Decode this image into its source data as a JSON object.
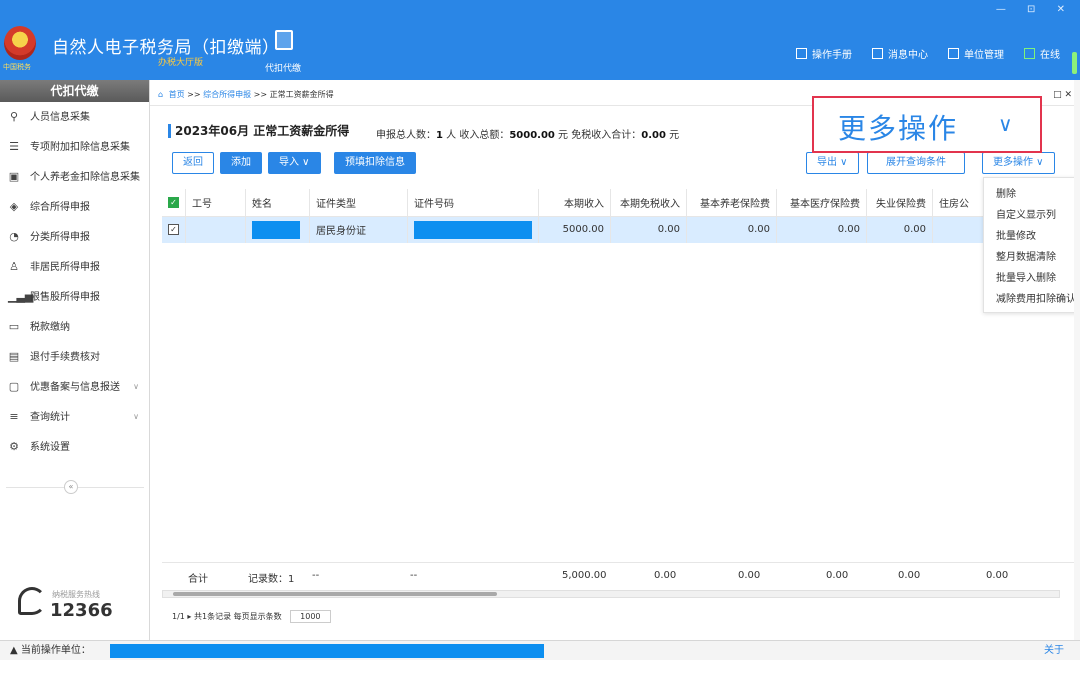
{
  "app": {
    "title": "自然人电子税务局（扣缴端）",
    "subtitle": "办税大厅版",
    "logo_text": "中国税务",
    "nav_label": "代扣代缴",
    "window_controls": "—  ⊡  ✕"
  },
  "top_actions": [
    {
      "label": "操作手册",
      "icon": "manual-icon"
    },
    {
      "label": "消息中心",
      "icon": "mail-icon"
    },
    {
      "label": "单位管理",
      "icon": "building-icon"
    },
    {
      "label": "在线",
      "icon": "online-icon"
    }
  ],
  "sidebar": {
    "header": "代扣代缴",
    "items": [
      {
        "label": "人员信息采集",
        "icon": "person-icon"
      },
      {
        "label": "专项附加扣除信息采集",
        "icon": "list-icon"
      },
      {
        "label": "个人养老金扣除信息采集",
        "icon": "pension-icon"
      },
      {
        "label": "综合所得申报",
        "icon": "layers-icon"
      },
      {
        "label": "分类所得申报",
        "icon": "pie-icon"
      },
      {
        "label": "非居民所得申报",
        "icon": "user-outline-icon"
      },
      {
        "label": "限售股所得申报",
        "icon": "bar-icon"
      },
      {
        "label": "税款缴纳",
        "icon": "wallet-icon"
      },
      {
        "label": "退付手续费核对",
        "icon": "doc-icon"
      },
      {
        "label": "优惠备案与信息报送",
        "icon": "folder-icon",
        "expandable": true
      },
      {
        "label": "查询统计",
        "icon": "search-list-icon",
        "expandable": true
      },
      {
        "label": "系统设置",
        "icon": "gear-icon"
      }
    ],
    "collapse": "«",
    "hotline_label": "纳税服务热线",
    "hotline_number": "12366"
  },
  "breadcrumb": {
    "home": "首页",
    "sep": ">>",
    "level1": "综合所得申报",
    "current": "正常工资薪金所得",
    "close": "□ ✕"
  },
  "page": {
    "title": "2023年06月 正常工资薪金所得",
    "stats_prefix": "申报总人数：",
    "stats_count": "1",
    "stats_count_unit": " 人   收入总额：",
    "stats_income": "5000.00",
    "stats_income_unit": " 元   免税收入合计：",
    "stats_exempt": "0.00",
    "stats_exempt_unit": " 元"
  },
  "toolbar": {
    "back": "返回",
    "add": "添加",
    "import": "导入 ∨",
    "prefill": "预填扣除信息",
    "export": "导出 ∨",
    "expand_query": "展开查询条件",
    "more": "更多操作 ∨"
  },
  "table": {
    "columns": [
      "工号",
      "姓名",
      "证件类型",
      "证件号码",
      "本期收入",
      "本期免税收入",
      "基本养老保险费",
      "基本医疗保险费",
      "失业保险费",
      "住房公"
    ],
    "rows": [
      {
        "id": "",
        "name": "",
        "id_type": "居民身份证",
        "id_number": "",
        "income": "5000.00",
        "exempt": "0.00",
        "pension": "0.00",
        "medical": "0.00",
        "unemployment": "0.00",
        "housing": ""
      }
    ]
  },
  "footer": {
    "total_label": "合计",
    "records": "记录数：1",
    "dash1": "--",
    "dash2": "--",
    "income": "5,000.00",
    "exempt": "0.00",
    "pension": "0.00",
    "medical": "0.00",
    "unemployment": "0.00",
    "housing": "0.00"
  },
  "pager": {
    "info": "1/1 ▸ 共1条记录  每页显示条数",
    "page_size": "1000"
  },
  "dropdown": {
    "items": [
      "删除",
      "自定义显示列",
      "批量修改",
      "整月数据清除",
      "批量导入删除",
      "减除费用扣除确认"
    ]
  },
  "highlight": {
    "text": "更多操作",
    "chevron": "∨"
  },
  "status": {
    "label": "当前操作单位：",
    "close": "关于"
  },
  "colors": {
    "brand_blue": "#2a86e6",
    "selected_row": "#d9ecff",
    "highlight_border": "#e2344d",
    "redaction": "#0d8ff0"
  }
}
